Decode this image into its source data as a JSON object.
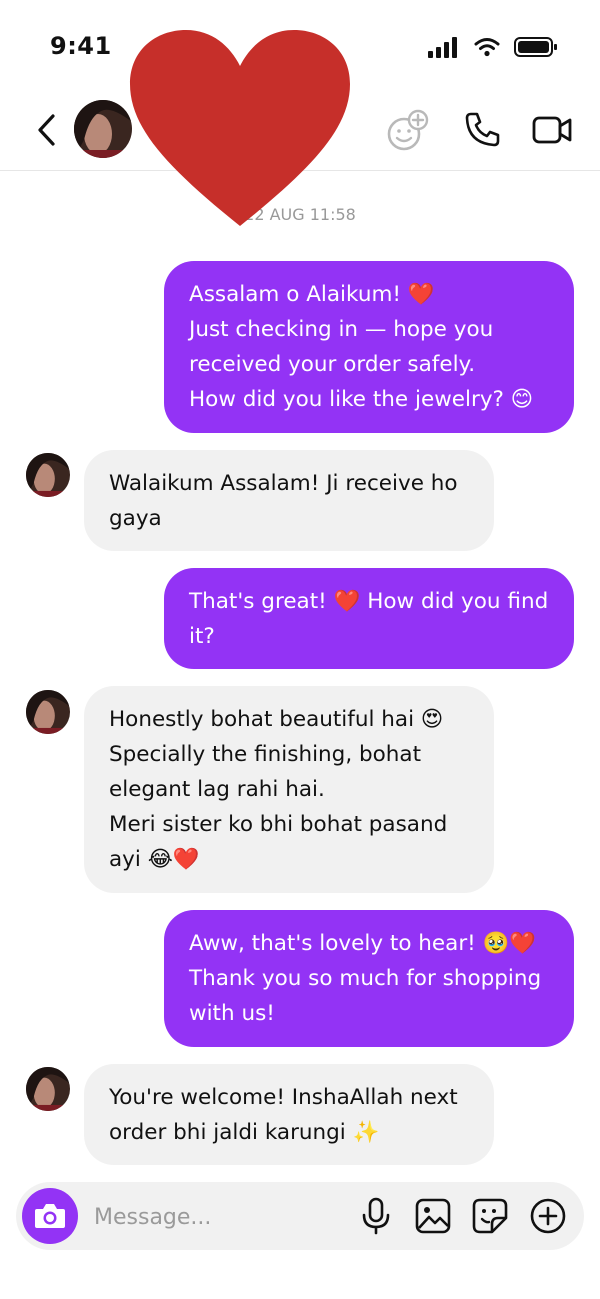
{
  "status_bar": {
    "time": "9:41"
  },
  "header": {
    "subtitle": "("
  },
  "date_separator": "22 AUG 11:58",
  "messages": [
    {
      "from": "me",
      "text": "Assalam o Alaikum! ❤️\nJust checking in — hope you received your order safely.\nHow did you like the jewelry? 😊"
    },
    {
      "from": "them",
      "text": "Walaikum Assalam! Ji receive ho gaya"
    },
    {
      "from": "me",
      "text": "That's great! ❤️ How did you find it?"
    },
    {
      "from": "them",
      "text": "Honestly bohat beautiful hai 😍\nSpecially the finishing, bohat elegant lag rahi hai.\nMeri sister ko bhi bohat pasand ayi 😂❤️"
    },
    {
      "from": "me",
      "text": "Aww, that's lovely to hear! 🥹❤️\nThank you so much for shopping with us!"
    },
    {
      "from": "them",
      "text": "You're welcome! InshaAllah next order bhi jaldi karungi ✨"
    }
  ],
  "composer": {
    "placeholder": "Message..."
  },
  "icons": {
    "back": "chevron-left-icon",
    "add_friend": "add-emoji-icon",
    "call": "phone-icon",
    "video": "video-camera-icon",
    "camera": "camera-icon",
    "mic": "microphone-icon",
    "gallery": "image-icon",
    "sticker": "sticker-icon",
    "plus": "plus-circle-icon"
  },
  "colors": {
    "accent": "#9333f5",
    "incoming_bubble": "#f1f1f1",
    "heart": "#c62f2a"
  }
}
